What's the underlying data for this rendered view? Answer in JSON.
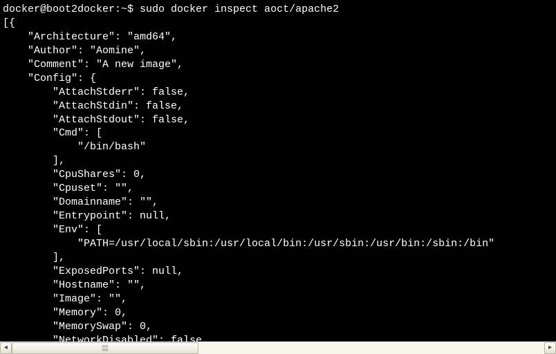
{
  "prompt": {
    "user_host": "docker@boot2docker",
    "path": "~",
    "symbol": "$",
    "command": "sudo docker inspect aoct/apache2"
  },
  "lines": [
    "docker@boot2docker:~$ sudo docker inspect aoct/apache2",
    "[{",
    "    \"Architecture\": \"amd64\",",
    "    \"Author\": \"Aomine\",",
    "    \"Comment\": \"A new image\",",
    "    \"Config\": {",
    "        \"AttachStderr\": false,",
    "        \"AttachStdin\": false,",
    "        \"AttachStdout\": false,",
    "        \"Cmd\": [",
    "            \"/bin/bash\"",
    "        ],",
    "        \"CpuShares\": 0,",
    "        \"Cpuset\": \"\",",
    "        \"Domainname\": \"\",",
    "        \"Entrypoint\": null,",
    "        \"Env\": [",
    "            \"PATH=/usr/local/sbin:/usr/local/bin:/usr/sbin:/usr/bin:/sbin:/bin\"",
    "        ],",
    "        \"ExposedPorts\": null,",
    "        \"Hostname\": \"\",",
    "        \"Image\": \"\",",
    "        \"Memory\": 0,",
    "        \"MemorySwap\": 0,",
    "        \"NetworkDisabled\": false,"
  ],
  "inspect_output": {
    "Architecture": "amd64",
    "Author": "Aomine",
    "Comment": "A new image",
    "Config": {
      "AttachStderr": false,
      "AttachStdin": false,
      "AttachStdout": false,
      "Cmd": [
        "/bin/bash"
      ],
      "CpuShares": 0,
      "Cpuset": "",
      "Domainname": "",
      "Entrypoint": null,
      "Env": [
        "PATH=/usr/local/sbin:/usr/local/bin:/usr/sbin:/usr/bin:/sbin:/bin"
      ],
      "ExposedPorts": null,
      "Hostname": "",
      "Image": "",
      "Memory": 0,
      "MemorySwap": 0,
      "NetworkDisabled": false
    }
  },
  "scrollbar": {
    "left_arrow": "◄",
    "right_arrow": "►"
  }
}
